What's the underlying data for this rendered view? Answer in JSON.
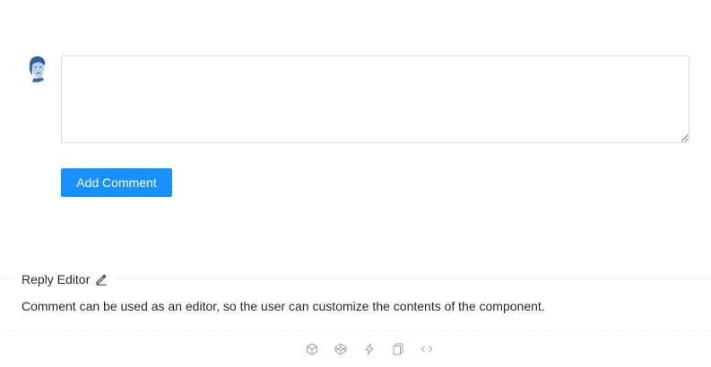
{
  "comment_form": {
    "textarea_value": "",
    "submit_label": "Add Comment"
  },
  "demo_meta": {
    "title": "Reply Editor",
    "description": "Comment can be used as an editor, so the user can customize the contents of the component."
  },
  "code_actions": [
    {
      "icon": "codesandbox-icon"
    },
    {
      "icon": "codepen-icon"
    },
    {
      "icon": "thunderbolt-icon"
    },
    {
      "icon": "copy-icon"
    },
    {
      "icon": "code-expand-icon"
    }
  ],
  "colors": {
    "primary": "#1890ff",
    "border": "#d9d9d9",
    "divider": "#f0f0f0",
    "icon_muted": "#a0a0a0"
  }
}
